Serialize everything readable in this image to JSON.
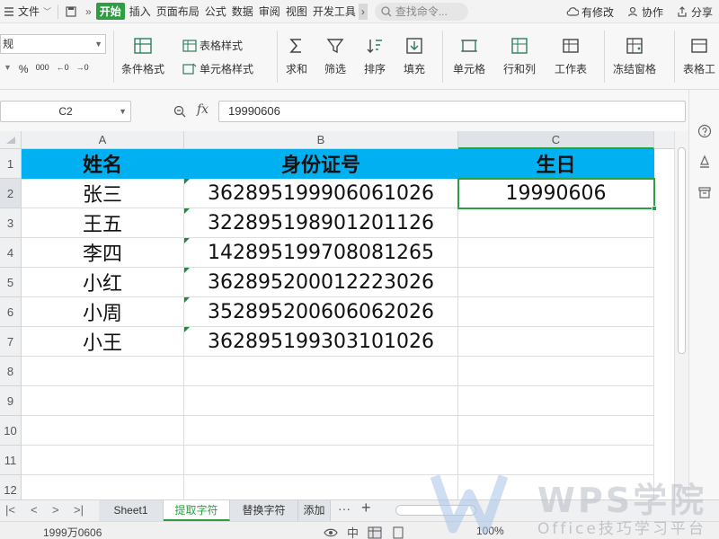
{
  "menu": {
    "file": "文件",
    "more": "»",
    "tabs": [
      "开始",
      "插入",
      "页面布局",
      "公式",
      "数据",
      "审阅",
      "视图",
      "开发工具"
    ],
    "search_placeholder": "查找命令...",
    "right": [
      "有修改",
      "协作",
      "分享"
    ]
  },
  "ribbon": {
    "format_box": "规",
    "num_buttons": [
      "%",
      "000",
      "←0",
      "→0"
    ],
    "cond_format": "条件格式",
    "table_style": "表格样式",
    "cell_style": "单元格样式",
    "sum": "求和",
    "filter": "筛选",
    "sort": "排序",
    "fill": "填充",
    "cell": "单元格",
    "row_col": "行和列",
    "worksheet": "工作表",
    "freeze": "冻结窗格",
    "table_tool": "表格工"
  },
  "formula": {
    "name_box": "C2",
    "fx": "fx",
    "value": "19990606"
  },
  "grid": {
    "columns": [
      "A",
      "B",
      "C"
    ],
    "rows": [
      "1",
      "2",
      "3",
      "4",
      "5",
      "6",
      "7",
      "8",
      "9",
      "10",
      "11",
      "12"
    ],
    "header": [
      "姓名",
      "身份证号",
      "生日"
    ],
    "data": [
      [
        "张三",
        "362895199906061026",
        "19990606"
      ],
      [
        "王五",
        "322895198901201126",
        ""
      ],
      [
        "李四",
        "142895199708081265",
        ""
      ],
      [
        "小红",
        "362895200012223026",
        ""
      ],
      [
        "小周",
        "352895200606062026",
        ""
      ],
      [
        "小王",
        "362895199303101026",
        ""
      ]
    ],
    "header_color": "#00b0f0",
    "selection_color": "#2e9e43"
  },
  "sheets": {
    "tabs": [
      "Sheet1",
      "提取字符",
      "替换字符",
      "添加字"
    ],
    "active": "提取字符",
    "more": "···",
    "add": "+"
  },
  "status": {
    "left": "1999万0606",
    "zoom": "100%"
  },
  "watermark": {
    "title": "WPS学院",
    "subtitle": "Office技巧学习平台"
  }
}
